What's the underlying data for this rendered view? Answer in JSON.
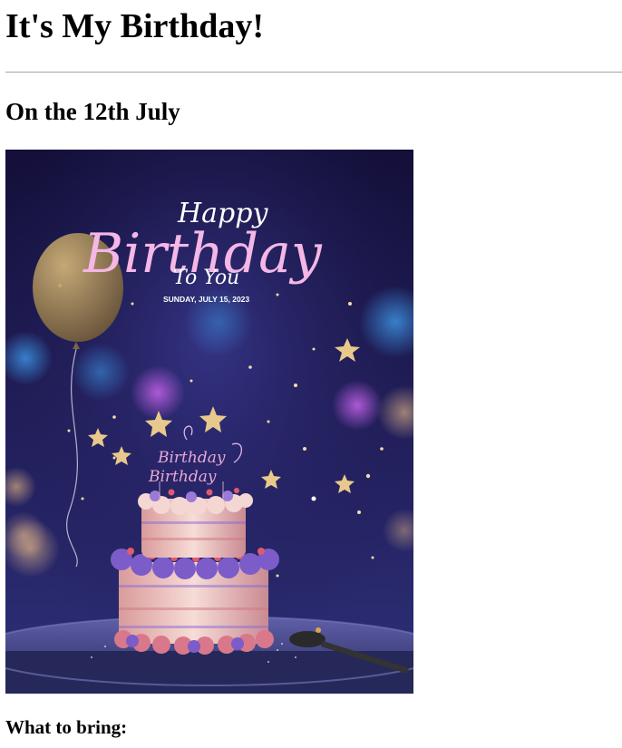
{
  "page": {
    "title": "It's My Birthday!",
    "date_heading": "On the 12th July",
    "bring_heading": "What to bring:"
  },
  "poster": {
    "script_top": "Happy",
    "script_main": "Birthday",
    "script_sub": "To You",
    "date_line": "SUNDAY, JULY 15, 2023",
    "cake_topper": "Birthday",
    "colors": {
      "background_top": "#16123d",
      "background_bottom": "#2a2a73",
      "script_pink": "#f4b7e6",
      "cake_cream": "#f5d7d2",
      "cake_purple": "#7b5cc9",
      "gold": "#e8c98b"
    }
  }
}
